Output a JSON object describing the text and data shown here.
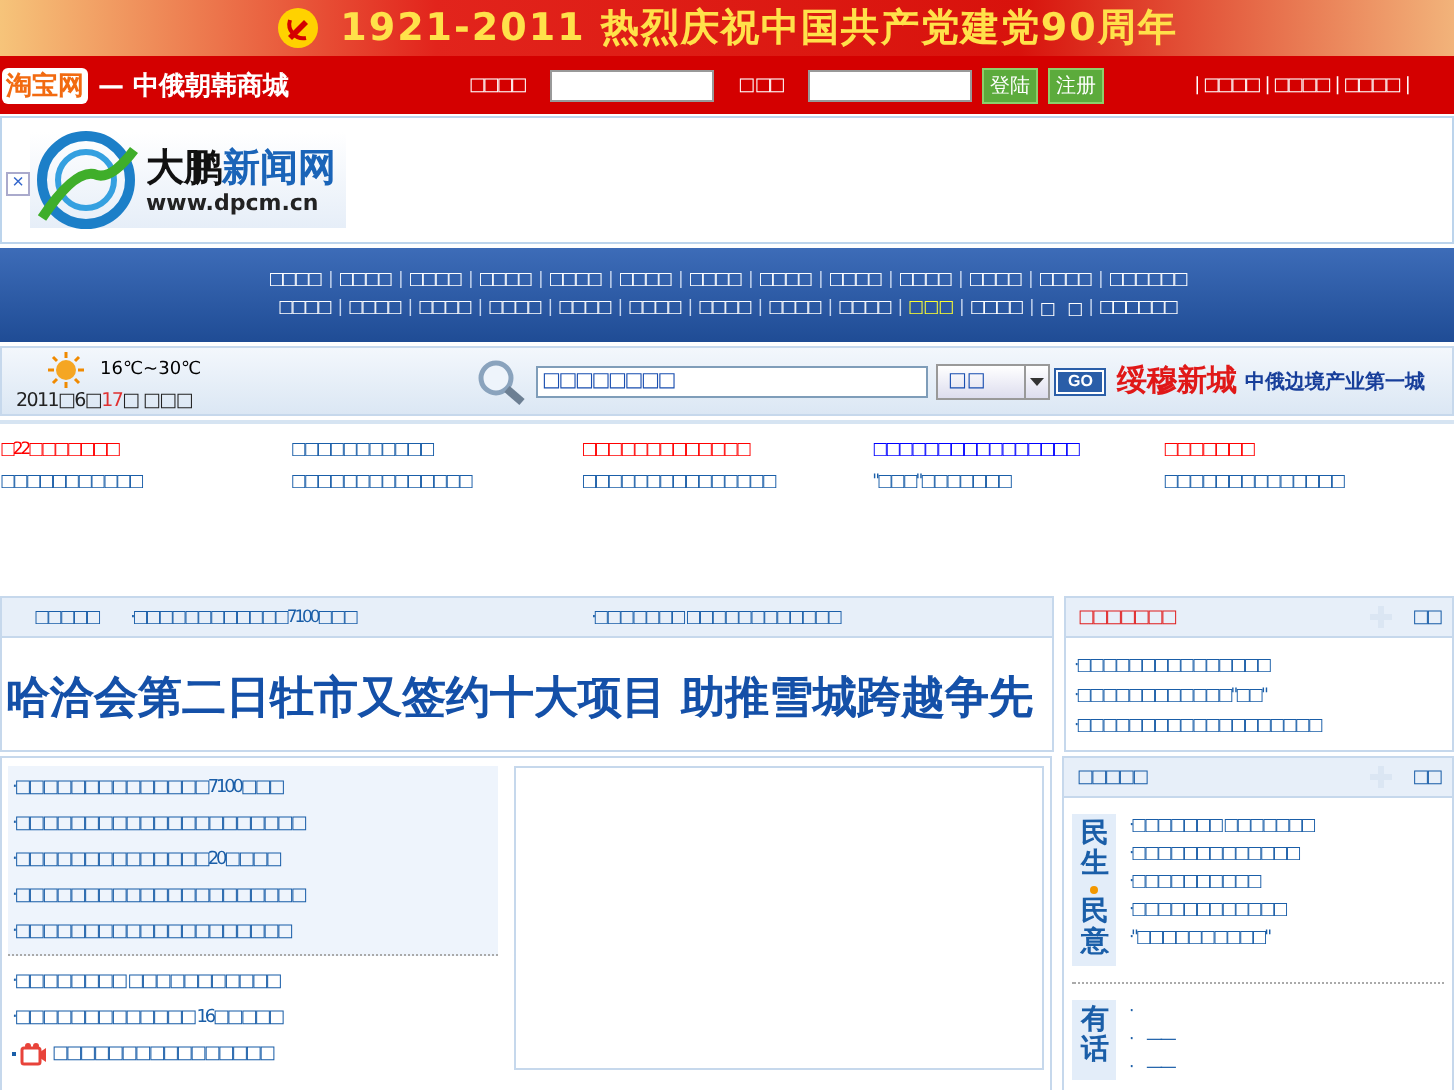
{
  "banner": {
    "title": "1921-2011 热烈庆祝中国共产党建党90周年"
  },
  "topbar": {
    "brand": "淘宝网",
    "shop": "— 中俄朝韩商城",
    "user_label": "□□□□",
    "pass_label": "□ □□",
    "login": "登陆",
    "register": "注册",
    "links": [
      "□□□□",
      "□□□□",
      "□□□□"
    ],
    "separator": "|"
  },
  "nav_separator": "|",
  "logo": {
    "name_a": "大鹏",
    "name_b": "新闻网",
    "url": "www.dpcm.cn",
    "close": "×"
  },
  "nav": [
    [
      {
        "label": "□□□□",
        "highlighted": false
      },
      {
        "label": "□□□□",
        "highlighted": false
      },
      {
        "label": "□□□□",
        "highlighted": false
      },
      {
        "label": "□□□□",
        "highlighted": false
      },
      {
        "label": "□□□□",
        "highlighted": false
      },
      {
        "label": "□□□□",
        "highlighted": false
      },
      {
        "label": "□□□□",
        "highlighted": false
      },
      {
        "label": "□□□□",
        "highlighted": false
      },
      {
        "label": "□□□□",
        "highlighted": false
      },
      {
        "label": "□□□□",
        "highlighted": false
      },
      {
        "label": "□□□□",
        "highlighted": false
      },
      {
        "label": "□□□□",
        "highlighted": false
      },
      {
        "label": "□□□□□□",
        "highlighted": false
      }
    ],
    [
      {
        "label": "□□□□",
        "highlighted": false
      },
      {
        "label": "□□□□",
        "highlighted": false
      },
      {
        "label": "□□□□",
        "highlighted": false
      },
      {
        "label": "□□□□",
        "highlighted": false
      },
      {
        "label": "□□□□",
        "highlighted": false
      },
      {
        "label": "□□□□",
        "highlighted": false
      },
      {
        "label": "□□□□",
        "highlighted": false
      },
      {
        "label": "□□□□",
        "highlighted": false
      },
      {
        "label": "□□□□",
        "highlighted": false
      },
      {
        "label": "□ □ □",
        "highlighted": true
      },
      {
        "label": "□□□□",
        "highlighted": false
      },
      {
        "label": "□　□",
        "highlighted": false
      },
      {
        "label": "□□□□□□",
        "highlighted": false
      }
    ]
  ],
  "infobar": {
    "temperature": "16℃~30℃",
    "date": {
      "prefix": "2011□6□",
      "day": "17",
      "suffix": "□ □□□"
    },
    "search_value": "□□□□□□□□",
    "select_value": "□ □",
    "go": "GO",
    "promo_a": "绥穆新城",
    "promo_b": "中俄边境产业第一城"
  },
  "links": [
    {
      "text": "□22□□□□□□□",
      "color": "#ff0000"
    },
    {
      "text": "□□□□□□□□□□□",
      "color": "#1a5ea8"
    },
    {
      "text": "□□□□□□□□□□□□□",
      "color": "#ff0000"
    },
    {
      "text": "□□□□□□□□□□□□□□□□",
      "color": "#0000ff"
    },
    {
      "text": "□□□□□□□",
      "color": "#ff0000"
    },
    {
      "text": "□□□□□□□□□□□",
      "color": "#1a5ea8"
    },
    {
      "text": "□□□□□□□□□□□□□□",
      "color": "#1a5ea8"
    },
    {
      "text": "□□□□□□□□□□□□□□□",
      "color": "#1a5ea8"
    },
    {
      "text": "\"□□□\"□□□□□□□",
      "color": "#1a5ea8"
    },
    {
      "text": "□□□□□□□□□□□□□□",
      "color": "#1a5ea8"
    }
  ],
  "headline": {
    "label": "□□□□□",
    "links": [
      "·□□□□□□□□□□□□7100□□□",
      "·□□□□□□□ □□□□□□□□□□□□"
    ],
    "title": "哈洽会第二日牡市又签约十大项目 助推雪城跨越争先"
  },
  "panel_a": {
    "title": "□□□□□□□",
    "more": "□□",
    "items": [
      "·□□□□□□□□□□□□□□□",
      "·□□□□□□□□□□□□\"□□\"",
      "·□□□□□□□□□□□□□□□□□□□"
    ]
  },
  "news": {
    "top": [
      "·□□□□□□□□□□□□□□7100□□□",
      "·□□□□□□□□□□□□□□□□□□□□□",
      "·□□□□□□□□□□□□□□20□□□□",
      "·□□□□□□□□□□□□□□□□□□□□□",
      "·□□□□□□□□□□□□□□□□□□□□"
    ],
    "more": [
      {
        "text": "·□□□□□□□□ □□□□□□□□□□□",
        "kind": "plain"
      },
      {
        "text": "·□□□□□□□□□□□□□ 16□□□□□",
        "kind": "plain"
      },
      {
        "text": "□□□□□□□□□□□□□□□□",
        "kind": "video"
      }
    ]
  },
  "panel_b": {
    "title": "□□□□□",
    "more": "□□",
    "sections": [
      {
        "label": [
          "民生",
          "民意"
        ],
        "items": [
          "·□□□□□□□ □□□□□□□",
          "·□□□□□□□□□□□□□",
          "·□□□□□□□□□□",
          "·□□□□□□□□□□□□",
          "·\"□□□□□□□□□□\""
        ]
      },
      {
        "label": [
          "有话"
        ],
        "items": [
          "·",
          "·　——",
          "·　——"
        ]
      }
    ]
  }
}
